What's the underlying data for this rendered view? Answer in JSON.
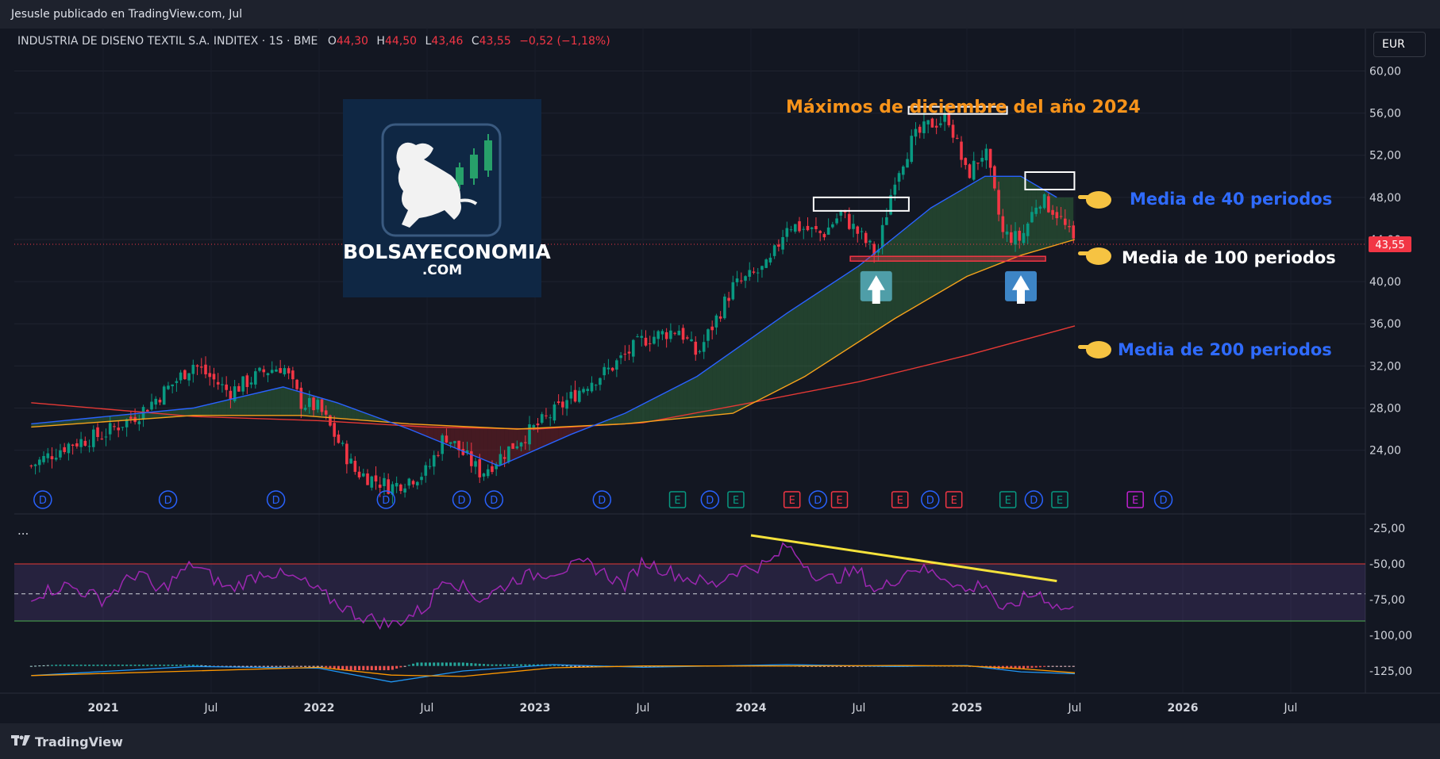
{
  "header": {
    "published_by": "Jesusle publicado en TradingView.com, Jul",
    "symbol": "INDUSTRIA DE DISENO TEXTIL S.A. INDITEX · 1S · BME",
    "o_label": "O",
    "o_value": "44,30",
    "h_label": "H",
    "h_value": "44,50",
    "l_label": "L",
    "l_value": "43,46",
    "c_label": "C",
    "c_value": "43,55",
    "change": "−0,52 (−1,18%)",
    "currency_button": "EUR"
  },
  "footer": {
    "brand": "TradingView"
  },
  "logo": {
    "line1": "BOLSAYECONOMIA",
    "line2": ".COM"
  },
  "annotations": {
    "title": "Máximos de diciembre del año 2024",
    "ma40": "Media de 40 periodos",
    "ma100": "Media de 100 periodos",
    "ma200": "Media de 200 periodos"
  },
  "colors": {
    "background": "#131722",
    "up": "#089981",
    "down": "#f23645",
    "ma40": "#2962ff",
    "ma100": "#f7a21b",
    "ma200": "#e53935",
    "rsi": "#9c27b0",
    "annotation_orange": "#f7931a",
    "annotation_blue": "#2f6bff"
  },
  "price_tag": "43,55",
  "indicator_pane_label": "...",
  "chart_data": [
    {
      "type": "candlestick",
      "interval": "1S (weekly)",
      "y_axis_ticks": [
        "60,00",
        "56,00",
        "52,00",
        "48,00",
        "44,00",
        "40,00",
        "36,00",
        "32,00",
        "28,00",
        "24,00"
      ],
      "x_axis_ticks": [
        "2021",
        "Jul",
        "2022",
        "Jul",
        "2023",
        "Jul",
        "2024",
        "Jul",
        "2025",
        "Jul",
        "2026",
        "Jul"
      ],
      "ylim": [
        21,
        62
      ],
      "last_price": 43.55,
      "close_path": [
        [
          "2020-09",
          22.5
        ],
        [
          "2020-11",
          24.5
        ],
        [
          "2021-01",
          25.5
        ],
        [
          "2021-03",
          27.5
        ],
        [
          "2021-05",
          30.5
        ],
        [
          "2021-06",
          32.2
        ],
        [
          "2021-08",
          29.5
        ],
        [
          "2021-10",
          31.5
        ],
        [
          "2021-11",
          32.0
        ],
        [
          "2021-12",
          28.5
        ],
        [
          "2022-01",
          28.0
        ],
        [
          "2022-03",
          22.0
        ],
        [
          "2022-05",
          20.5
        ],
        [
          "2022-07",
          22.0
        ],
        [
          "2022-08",
          25.5
        ],
        [
          "2022-10",
          21.8
        ],
        [
          "2022-12",
          24.8
        ],
        [
          "2023-02",
          27.5
        ],
        [
          "2023-04",
          30.5
        ],
        [
          "2023-05",
          31.5
        ],
        [
          "2023-07",
          34.5
        ],
        [
          "2023-09",
          35.5
        ],
        [
          "2023-10",
          33.0
        ],
        [
          "2023-12",
          39.5
        ],
        [
          "2024-02",
          41.5
        ],
        [
          "2024-03",
          45.5
        ],
        [
          "2024-05",
          44.5
        ],
        [
          "2024-06",
          46.5
        ],
        [
          "2024-08",
          42.5
        ],
        [
          "2024-09",
          50.0
        ],
        [
          "2024-10",
          53.5
        ],
        [
          "2024-11",
          55.0
        ],
        [
          "2024-12",
          55.5
        ],
        [
          "2025-01",
          50.0
        ],
        [
          "2025-02",
          52.5
        ],
        [
          "2025-03",
          44.5
        ],
        [
          "2025-04",
          44.0
        ],
        [
          "2025-05",
          48.0
        ],
        [
          "2025-06",
          46.5
        ],
        [
          "2025-07",
          43.55
        ]
      ],
      "series": [
        {
          "name": "Media de 40 periodos",
          "points": [
            [
              "2020-09",
              26.5
            ],
            [
              "2021-06",
              28.0
            ],
            [
              "2021-11",
              30.0
            ],
            [
              "2022-02",
              28.5
            ],
            [
              "2022-06",
              26.0
            ],
            [
              "2022-11",
              22.5
            ],
            [
              "2023-03",
              25.5
            ],
            [
              "2023-06",
              27.5
            ],
            [
              "2023-10",
              31.0
            ],
            [
              "2024-03",
              37.0
            ],
            [
              "2024-07",
              41.5
            ],
            [
              "2024-11",
              47.0
            ],
            [
              "2025-02",
              50.0
            ],
            [
              "2025-04",
              50.0
            ],
            [
              "2025-06",
              48.0
            ]
          ]
        },
        {
          "name": "Media de 100 periodos",
          "points": [
            [
              "2020-09",
              26.2
            ],
            [
              "2021-06",
              27.3
            ],
            [
              "2021-12",
              27.3
            ],
            [
              "2022-06",
              26.5
            ],
            [
              "2022-12",
              26.0
            ],
            [
              "2023-06",
              26.5
            ],
            [
              "2023-12",
              27.5
            ],
            [
              "2024-04",
              31.0
            ],
            [
              "2024-09",
              36.5
            ],
            [
              "2025-01",
              40.5
            ],
            [
              "2025-04",
              42.5
            ],
            [
              "2025-07",
              44.0
            ]
          ]
        },
        {
          "name": "Media de 200 periodos",
          "points": [
            [
              "2020-09",
              28.5
            ],
            [
              "2021-06",
              27.2
            ],
            [
              "2022-01",
              26.8
            ],
            [
              "2022-07",
              26.2
            ],
            [
              "2023-01",
              26.0
            ],
            [
              "2023-07",
              26.6
            ],
            [
              "2024-01",
              28.5
            ],
            [
              "2024-07",
              30.5
            ],
            [
              "2025-01",
              33.0
            ],
            [
              "2025-07",
              35.8
            ]
          ]
        }
      ]
    },
    {
      "type": "line",
      "y_axis_ticks": [
        "-25,00",
        "-50,00",
        "-75,00",
        "-100,00",
        "-125,00"
      ],
      "ylim": [
        -135,
        -20
      ],
      "band": [
        -50,
        -90
      ],
      "midline": -71,
      "values_path": [
        [
          "2020-09",
          -72
        ],
        [
          "2020-11",
          -65
        ],
        [
          "2021-01",
          -75
        ],
        [
          "2021-03",
          -55
        ],
        [
          "2021-04",
          -70
        ],
        [
          "2021-06",
          -50
        ],
        [
          "2021-08",
          -68
        ],
        [
          "2021-10",
          -55
        ],
        [
          "2021-12",
          -62
        ],
        [
          "2022-01",
          -70
        ],
        [
          "2022-03",
          -85
        ],
        [
          "2022-05",
          -93
        ],
        [
          "2022-07",
          -80
        ],
        [
          "2022-08",
          -58
        ],
        [
          "2022-10",
          -75
        ],
        [
          "2022-12",
          -60
        ],
        [
          "2023-02",
          -55
        ],
        [
          "2023-04",
          -50
        ],
        [
          "2023-06",
          -65
        ],
        [
          "2023-07",
          -48
        ],
        [
          "2023-09",
          -58
        ],
        [
          "2023-11",
          -65
        ],
        [
          "2023-12",
          -55
        ],
        [
          "2024-02",
          -50
        ],
        [
          "2024-03",
          -37
        ],
        [
          "2024-05",
          -62
        ],
        [
          "2024-07",
          -55
        ],
        [
          "2024-08",
          -70
        ],
        [
          "2024-10",
          -52
        ],
        [
          "2024-12",
          -60
        ],
        [
          "2025-01",
          -70
        ],
        [
          "2025-02",
          -62
        ],
        [
          "2025-03",
          -85
        ],
        [
          "2025-04",
          -75
        ],
        [
          "2025-05",
          -70
        ],
        [
          "2025-06",
          -80
        ],
        [
          "2025-07",
          -83
        ]
      ],
      "trendline": [
        [
          "2024-01",
          -30
        ],
        [
          "2025-06",
          -62
        ]
      ]
    },
    {
      "type": "line",
      "y_axis_ticks": [],
      "series": [
        {
          "name": "",
          "points": [
            [
              "2020-09",
              -130
            ],
            [
              "2021-06",
              -120
            ],
            [
              "2022-01",
              -122
            ],
            [
              "2022-05",
              -137
            ],
            [
              "2022-09",
              -125
            ],
            [
              "2023-02",
              -118
            ],
            [
              "2023-07",
              -121
            ],
            [
              "2024-03",
              -118
            ],
            [
              "2024-09",
              -120
            ],
            [
              "2025-01",
              -119
            ],
            [
              "2025-04",
              -126
            ],
            [
              "2025-07",
              -128
            ]
          ]
        }
      ]
    }
  ]
}
